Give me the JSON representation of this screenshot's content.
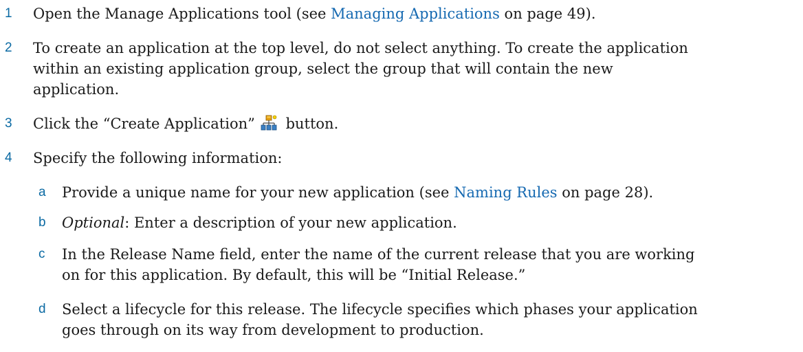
{
  "steps": [
    {
      "num": "1",
      "pre": "Open the Manage Applications tool (see ",
      "link": "Managing Applications",
      "post": " on page 49)."
    },
    {
      "num": "2",
      "lines": [
        "To create an application at the top level, do not select anything. To create the application",
        "within an existing application group, select the group that will contain the new",
        "application."
      ]
    },
    {
      "num": "3",
      "pre": "Click the “Create Application”",
      "post": " button.",
      "icon": "create-application-icon"
    },
    {
      "num": "4",
      "text": "Specify the following information:"
    }
  ],
  "substeps": [
    {
      "letter": "a",
      "pre": "Provide a unique name for your new application (see ",
      "link": "Naming Rules",
      "post": " on page 28)."
    },
    {
      "letter": "b",
      "italic": "Optional",
      "post": ": Enter a description of your new application."
    },
    {
      "letter": "c",
      "lines": [
        "In the Release Name field, enter the name of the current release that you are working",
        "on for this application. By default, this will be “Initial Release.”"
      ]
    },
    {
      "letter": "d",
      "lines": [
        "Select a lifecycle for this release. The lifecycle specifies which phases your application",
        "goes through on its way from development to production."
      ]
    }
  ],
  "colors": {
    "marker": "#0b6aa3",
    "link": "#1569b1",
    "text": "#1a1a1a"
  }
}
